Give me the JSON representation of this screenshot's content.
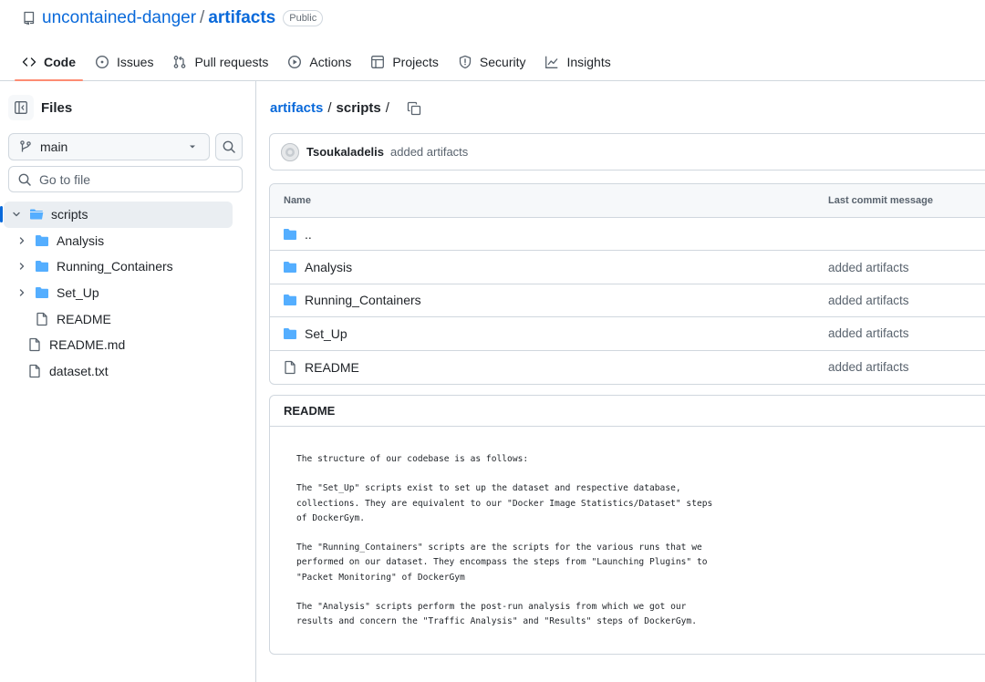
{
  "repo": {
    "owner": "uncontained-danger",
    "separator": "/",
    "name": "artifacts",
    "visibility": "Public"
  },
  "tabs": [
    {
      "label": "Code",
      "icon": "code-icon",
      "active": true
    },
    {
      "label": "Issues",
      "icon": "issue-icon"
    },
    {
      "label": "Pull requests",
      "icon": "pull-request-icon"
    },
    {
      "label": "Actions",
      "icon": "play-icon"
    },
    {
      "label": "Projects",
      "icon": "table-icon"
    },
    {
      "label": "Security",
      "icon": "shield-icon"
    },
    {
      "label": "Insights",
      "icon": "graph-icon"
    }
  ],
  "sidebar": {
    "title": "Files",
    "branch": "main",
    "goto_placeholder": "Go to file",
    "tree": [
      {
        "label": "scripts",
        "type": "folder-open",
        "expanded": true,
        "selected": true
      },
      {
        "label": "Analysis",
        "type": "folder"
      },
      {
        "label": "Running_Containers",
        "type": "folder"
      },
      {
        "label": "Set_Up",
        "type": "folder"
      },
      {
        "label": "README",
        "type": "file"
      },
      {
        "label": "README.md",
        "type": "file"
      },
      {
        "label": "dataset.txt",
        "type": "file"
      }
    ]
  },
  "breadcrumb": {
    "root": "artifacts",
    "sep1": "/",
    "current": "scripts",
    "sep2": "/"
  },
  "commit": {
    "author": "Tsoukaladelis",
    "message": "added artifacts"
  },
  "table": {
    "headers": [
      "Name",
      "Last commit message"
    ],
    "rows": [
      {
        "name": "..",
        "type": "folder",
        "message": ""
      },
      {
        "name": "Analysis",
        "type": "folder",
        "message": "added artifacts"
      },
      {
        "name": "Running_Containers",
        "type": "folder",
        "message": "added artifacts"
      },
      {
        "name": "Set_Up",
        "type": "folder",
        "message": "added artifacts"
      },
      {
        "name": "README",
        "type": "file",
        "message": "added artifacts"
      }
    ]
  },
  "readme": {
    "title": "README",
    "paragraphs": [
      "The structure of our codebase is as follows:",
      "The \"Set_Up\" scripts exist to set up the dataset and respective database,\ncollections. They are equivalent to our \"Docker Image Statistics/Dataset\" steps\nof DockerGym.",
      "The \"Running_Containers\" scripts are the scripts for the various runs that we\nperformed on our dataset. They encompass the steps from \"Launching Plugins\" to\n\"Packet Monitoring\" of DockerGym",
      "The \"Analysis\" scripts perform the post-run analysis from which we got our\nresults and concern the \"Traffic Analysis\" and \"Results\" steps of DockerGym."
    ]
  },
  "colors": {
    "accent": "#0969da",
    "folder": "#54aeff",
    "active_tab_underline": "#fd8c73",
    "border": "#d0d7de"
  }
}
